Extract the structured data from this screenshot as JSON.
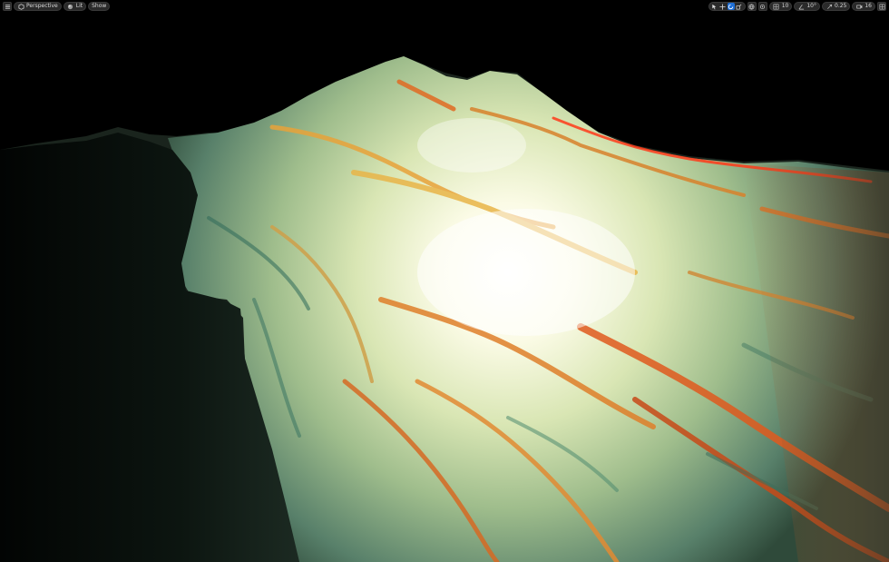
{
  "toolbar": {
    "left": {
      "menu_icon": "hamburger-icon",
      "perspective_label": "Perspective",
      "lit_label": "Lit",
      "show_label": "Show"
    },
    "right": {
      "grid_snap_value": "10",
      "rotation_snap_value": "10°",
      "scale_snap_value": "0.25",
      "camera_speed_value": "16"
    }
  },
  "colors": {
    "accent": "#1f6fd6",
    "toolbar_bg": "#2a2a2a",
    "viewport_bg": "#000000"
  }
}
